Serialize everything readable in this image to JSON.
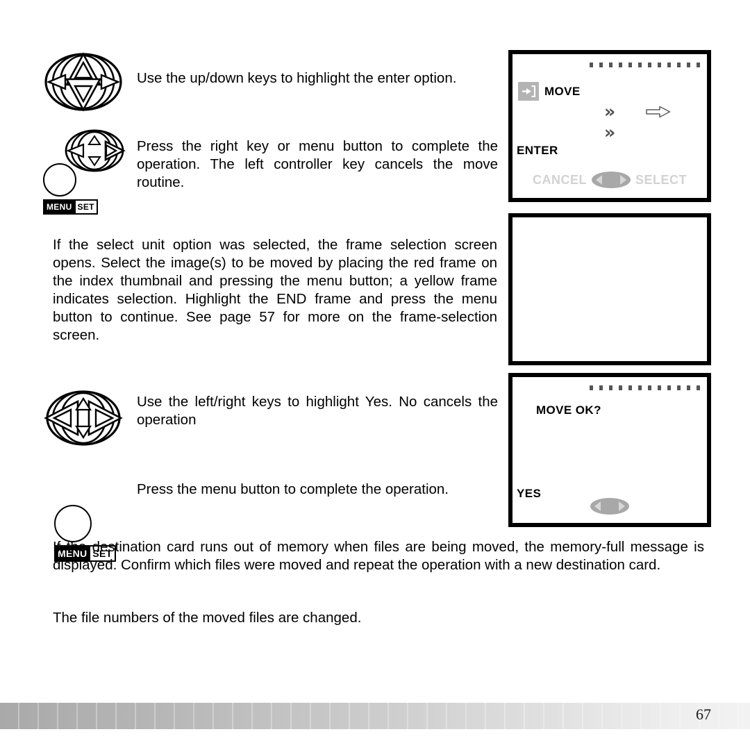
{
  "page": {
    "number": "67"
  },
  "steps": [
    {
      "icon": "four-way-controller-updown",
      "text": "Use the up/down keys to highlight the enter option."
    },
    {
      "icon": "four-way-controller-right",
      "text": "Press the right key or menu button to complete the operation. The left controller key cancels the move routine."
    },
    {
      "icon": "four-way-controller-leftright",
      "text": "Use the left/right keys to highlight  Yes.   No cancels the operation"
    },
    {
      "icon": "menu-set-button",
      "text": "Press the menu button to complete the operation."
    }
  ],
  "menu_button": {
    "menu_label": "MENU",
    "set_label": "SET"
  },
  "paragraphs": {
    "select_unit": "If the select unit option was selected, the frame selection screen opens. Select the image(s) to be moved by placing the red frame on the index thumbnail and pressing the menu button; a yellow frame indicates selection. Highlight the  END  frame and press the menu button to continue. See page 57 for more on the frame-selection screen.",
    "memory_full": "If the destination card runs out of memory when files are being moved, the memory-full message is displayed. Confirm which files were moved and repeat the operation with a new destination card.",
    "file_numbers": "The file numbers of the moved files are changed."
  },
  "lcd_screens": [
    {
      "id": "move-enter-screen",
      "move_icon": "enter-into-folder-icon",
      "move_label": "MOVE",
      "chevron_1": "»",
      "chevron_2": "»",
      "arrow_icon": "hollow-right-arrow",
      "enter_label": "ENTER",
      "guide_left": "CANCEL",
      "guide_right": "SELECT",
      "guide_pad": "left-right-controller-pad"
    },
    {
      "id": "frame-selection-screen",
      "content": ""
    },
    {
      "id": "move-confirm-screen",
      "title": "MOVE OK?",
      "option": "YES",
      "guide_pad": "left-right-controller-pad"
    }
  ],
  "colors": {
    "lcd_border": "#000000",
    "lcd_background": "#ffffff",
    "move_icon_bg": "#b3b3b3",
    "guide_text": "#d2d2d2",
    "guide_pad": "#a8a8a8",
    "chevron": "#4f4f4f"
  }
}
